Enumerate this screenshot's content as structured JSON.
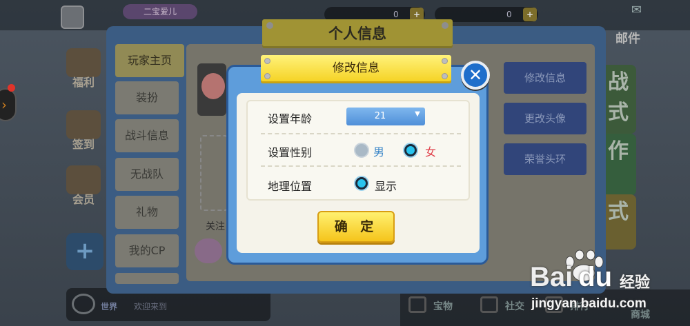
{
  "top_bar": {
    "player_name": "二宝爱儿",
    "coins": "0",
    "diamonds": "0",
    "mail_label": "邮件"
  },
  "left_icons": [
    {
      "label": "福利",
      "icon": "gift-icon"
    },
    {
      "label": "签到",
      "icon": "calendar-icon"
    },
    {
      "label": "会员",
      "icon": "crown-icon"
    }
  ],
  "right_modes": [
    "战式",
    "作",
    "式"
  ],
  "panel": {
    "title": "个人信息",
    "tabs": [
      "玩家主页",
      "装扮",
      "战斗信息",
      "无战队",
      "礼物",
      "我的CP"
    ],
    "follow_label": "关注",
    "right_buttons": [
      "修改信息",
      "更改头像",
      "荣誉头环"
    ]
  },
  "chat": {
    "channel": "世界",
    "preview": "欢迎来到"
  },
  "bottom_tabs": [
    "宝物",
    "社交",
    "排行",
    "商城"
  ],
  "modal": {
    "title": "修改信息",
    "close_icon": "close-icon",
    "rows": {
      "age_label": "设置年龄",
      "age_value": "21",
      "gender_label": "设置性别",
      "gender_male": "男",
      "gender_female": "女",
      "gender_selected": "女",
      "location_label": "地理位置",
      "location_option": "显示"
    },
    "confirm_label": "确 定"
  },
  "watermark": {
    "logo_left": "Bai",
    "logo_right": "du",
    "cn": "经验",
    "url": "jingyan.baidu.com"
  },
  "colors": {
    "modal_bg": "#5e9ddb",
    "title_yellow": "#f5d326",
    "radio_active": "#29c4ee",
    "male_color": "#3a86c8",
    "female_color": "#e0404a"
  }
}
